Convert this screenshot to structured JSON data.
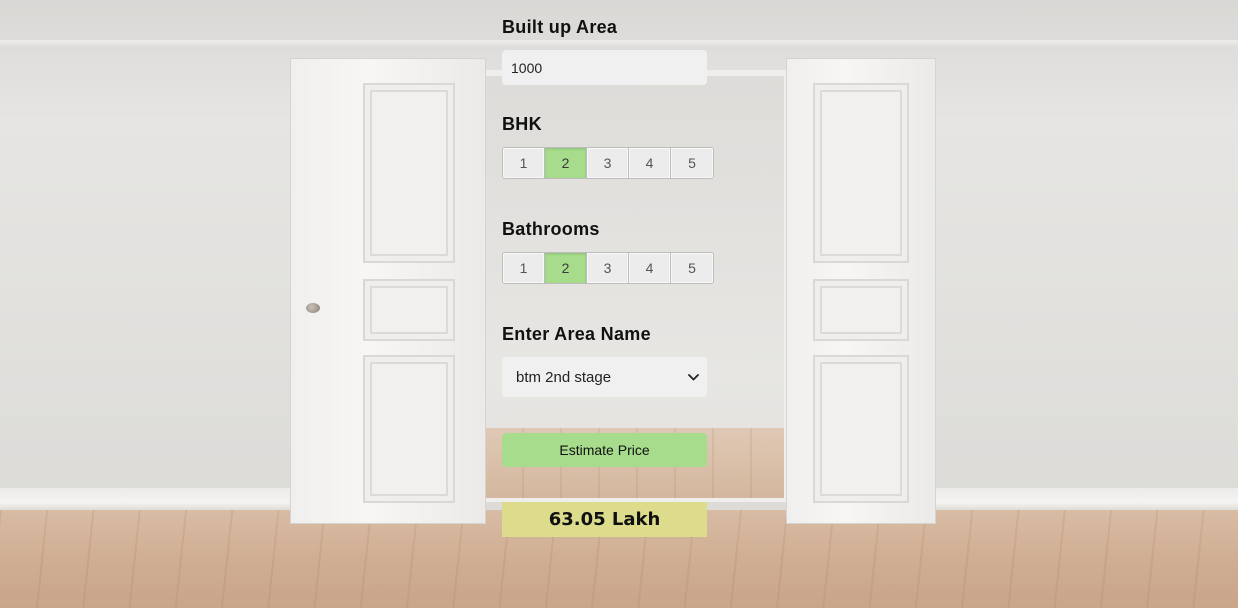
{
  "area": {
    "label": "Built up Area",
    "value": "1000"
  },
  "bhk": {
    "label": "BHK",
    "options": [
      "1",
      "2",
      "3",
      "4",
      "5"
    ],
    "selected": "2"
  },
  "bathrooms": {
    "label": "Bathrooms",
    "options": [
      "1",
      "2",
      "3",
      "4",
      "5"
    ],
    "selected": "2"
  },
  "location": {
    "label": "Enter Area Name",
    "selected": "btm 2nd stage"
  },
  "estimate_button": {
    "label": "Estimate Price"
  },
  "result": {
    "text": "63.05 Lakh"
  },
  "colors": {
    "accent_green": "#a6dc8b",
    "result_yellow": "#dcdc8c",
    "input_bg": "#f0f0f0"
  },
  "icons": {
    "select_arrow": "chevron-down-icon"
  }
}
